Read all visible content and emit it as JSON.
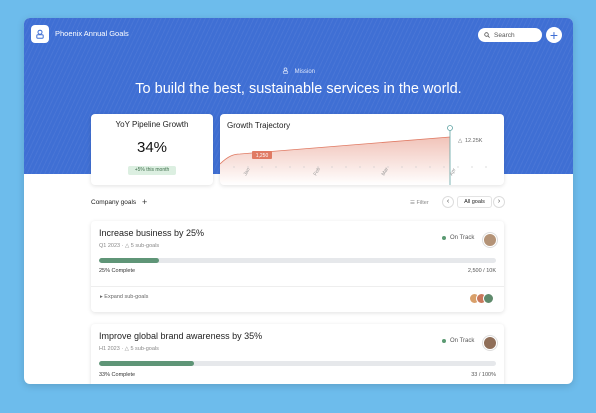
{
  "header": {
    "app_title": "Phoenix Annual Goals",
    "search_placeholder": "Search",
    "add_label": "+"
  },
  "mission": {
    "label": "Mission",
    "text": "To build the best, sustainable services in the world."
  },
  "yoy_card": {
    "title": "YoY Pipeline Growth",
    "value": "34%",
    "badge": "+5% this month"
  },
  "trajectory_card": {
    "title": "Growth Trajectory",
    "start_label": "1,250",
    "end_label": "12.25K",
    "months": [
      "Jan",
      "Feb",
      "Mar",
      "Apr"
    ]
  },
  "goals_section": {
    "header": "Company goals",
    "add_label": "+",
    "filter_label": "Filter",
    "prev_label": "‹",
    "next_label": "›",
    "scope_label": "All goals"
  },
  "goals": [
    {
      "title": "Increase business by 25%",
      "meta": "Q1 2023 · △ 5 sub-goals",
      "status": "On Track",
      "progress": 0.15,
      "complete_label": "25% Complete",
      "count_label": "2,500 / 10K",
      "expand_label": "▸  Expand sub-goals"
    },
    {
      "title": "Improve global brand awareness by 35%",
      "meta": "H1 2023 · △ 5 sub-goals",
      "status": "On Track",
      "progress": 0.24,
      "complete_label": "33% Complete",
      "count_label": "33 / 100%"
    }
  ],
  "colors": {
    "hero": "#3f6fd4",
    "accent_green": "#5f9577",
    "trajectory_line": "#e07a63"
  }
}
